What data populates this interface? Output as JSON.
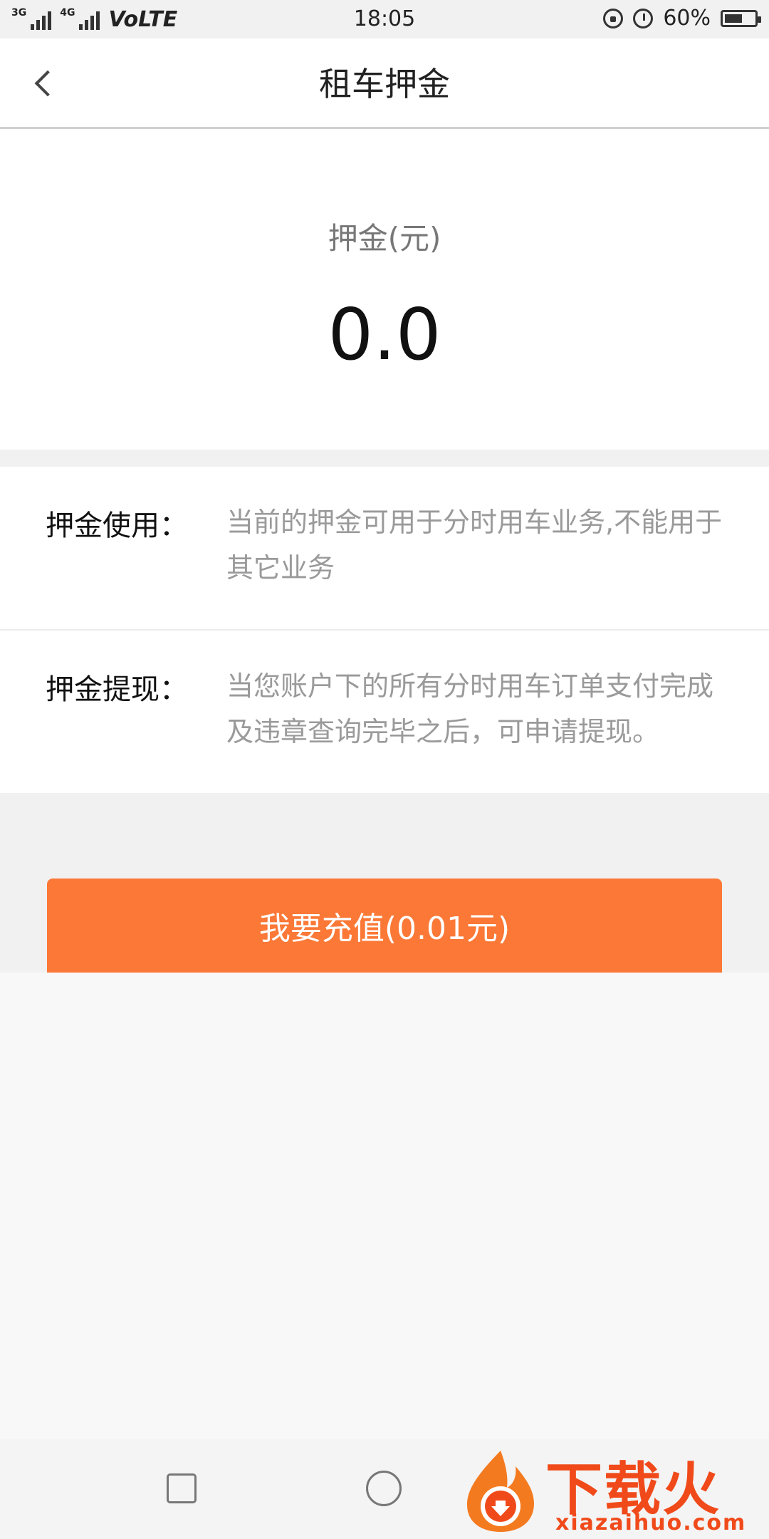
{
  "status_bar": {
    "network_3g": "3G",
    "network_4g": "4G",
    "volte": "VoLTE",
    "time": "18:05",
    "battery_percent": "60%",
    "battery_level": 0.6
  },
  "header": {
    "title": "租车押金"
  },
  "deposit": {
    "label": "押金(元)",
    "amount": "0.0"
  },
  "info": {
    "usage_title": "押金使用：",
    "usage_desc": "当前的押金可用于分时用车业务,不能用于其它业务",
    "withdraw_title": "押金提现：",
    "withdraw_desc": "当您账户下的所有分时用车订单支付完成及违章查询完毕之后，可申请提现。"
  },
  "actions": {
    "recharge_label": "我要充值(0.01元)"
  },
  "watermark": {
    "brand": "下载火",
    "url": "xiazaihuo.com"
  },
  "colors": {
    "accent": "#fb7836",
    "watermark": "#f04a1a"
  }
}
